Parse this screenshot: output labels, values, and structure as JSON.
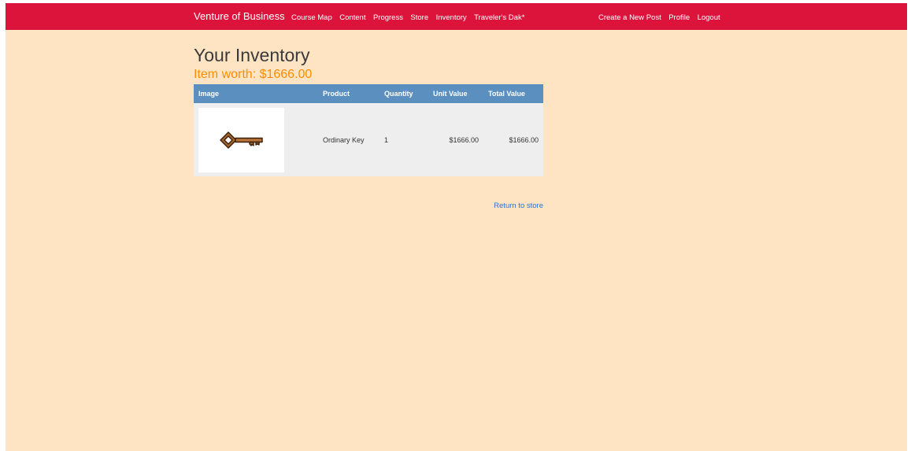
{
  "nav": {
    "brand": "Venture of Business",
    "left_items": [
      "Course Map",
      "Content",
      "Progress",
      "Store",
      "Inventory",
      "Traveler's Dak*"
    ],
    "right_items": [
      "Create a New Post",
      "Profile",
      "Logout"
    ]
  },
  "page": {
    "title": "Your Inventory",
    "worth": "Item worth: $1666.00"
  },
  "table": {
    "headers": [
      "Image",
      "Product",
      "Quantity",
      "Unit Value",
      "Total Value"
    ],
    "rows": [
      {
        "image_icon": "key-icon",
        "product": "Ordinary Key",
        "quantity": "1",
        "unit_value": "$1666.00",
        "total_value": "$1666.00"
      }
    ]
  },
  "return_link": "Return to store",
  "colors": {
    "navbar": "#dc143c",
    "background": "#ffe4c4",
    "table_header": "#5b8fbf",
    "worth_text": "#ff8c00",
    "link": "#2e6ecf"
  }
}
